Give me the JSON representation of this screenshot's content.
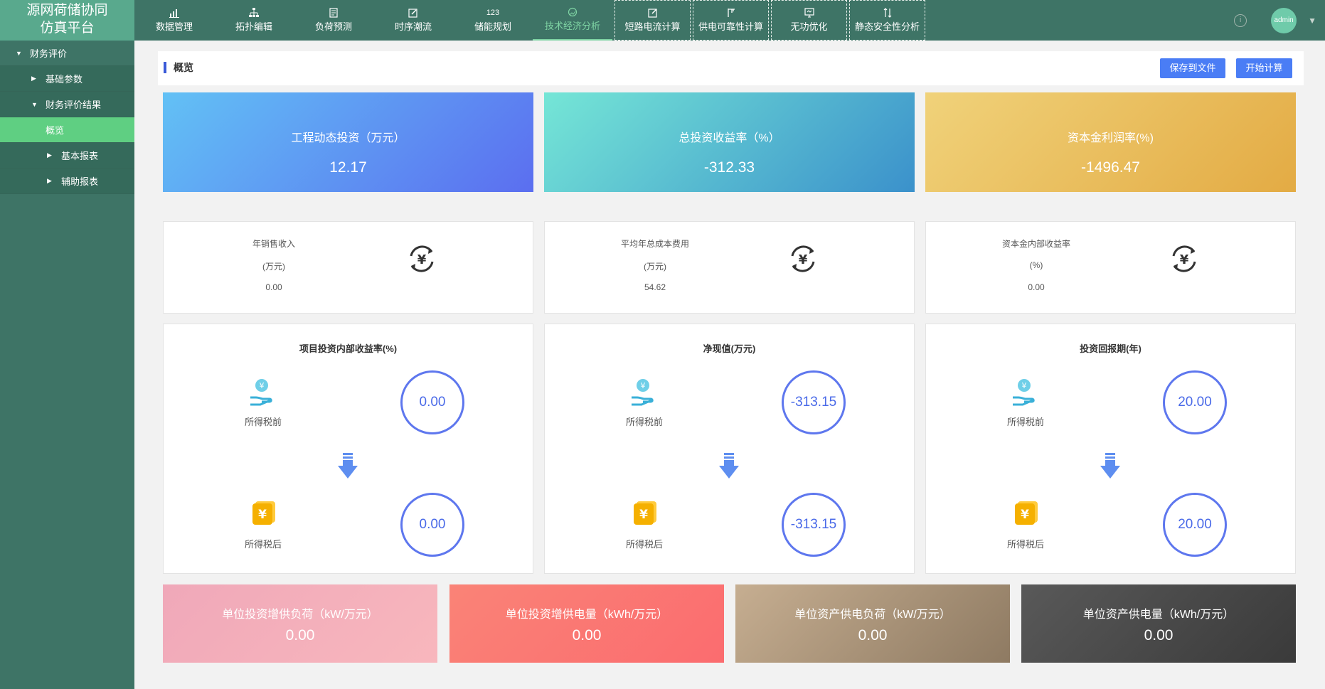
{
  "app": {
    "title_line1": "源网荷储协同",
    "title_line2": "仿真平台"
  },
  "nav": [
    {
      "label": "数据管理",
      "icon": "bar-chart-icon"
    },
    {
      "label": "拓扑编辑",
      "icon": "topology-icon"
    },
    {
      "label": "负荷预测",
      "icon": "document-icon"
    },
    {
      "label": "时序潮流",
      "icon": "edit-icon"
    },
    {
      "label": "储能规划",
      "icon": "numbers-icon",
      "icon_text": "123"
    },
    {
      "label": "技术经济分析",
      "icon": "chart-icon",
      "active": true
    },
    {
      "label": "短路电流计算",
      "icon": "edit-box-icon"
    },
    {
      "label": "供电可靠性计算",
      "icon": "tower-icon"
    },
    {
      "label": "无功优化",
      "icon": "monitor-icon"
    },
    {
      "label": "静态安全性分析",
      "icon": "transfer-icon"
    }
  ],
  "user": {
    "name": "admin"
  },
  "sidebar": {
    "items": [
      {
        "label": "财务评价",
        "level": 0,
        "arrow": "▼"
      },
      {
        "label": "基础参数",
        "level": 1,
        "arrow": "▶"
      },
      {
        "label": "财务评价结果",
        "level": 1,
        "arrow": "▼"
      },
      {
        "label": "概览",
        "level": 2,
        "arrow": "",
        "active": true
      },
      {
        "label": "基本报表",
        "level": 2,
        "arrow": "▶"
      },
      {
        "label": "辅助报表",
        "level": 2,
        "arrow": "▶"
      }
    ]
  },
  "header": {
    "title": "概览",
    "save_label": "保存到文件",
    "calc_label": "开始计算"
  },
  "top_cards": [
    {
      "title": "工程动态投资（万元）",
      "value": "12.17"
    },
    {
      "title": "总投资收益率（%）",
      "value": "-312.33"
    },
    {
      "title": "资本金利润率(%)",
      "value": "-1496.47"
    }
  ],
  "small_cards": [
    {
      "label": "年销售收入",
      "unit": "(万元)",
      "value": "0.00"
    },
    {
      "label": "平均年总成本费用",
      "unit": "(万元)",
      "value": "54.62"
    },
    {
      "label": "资本金内部收益率",
      "unit": "(%)",
      "value": "0.00"
    }
  ],
  "big_cards": [
    {
      "title": "项目投资内部收益率(%)",
      "before_label": "所得税前",
      "before_value": "0.00",
      "after_label": "所得税后",
      "after_value": "0.00"
    },
    {
      "title": "净现值(万元)",
      "before_label": "所得税前",
      "before_value": "-313.15",
      "after_label": "所得税后",
      "after_value": "-313.15"
    },
    {
      "title": "投资回报期(年)",
      "before_label": "所得税前",
      "before_value": "20.00",
      "after_label": "所得税后",
      "after_value": "20.00"
    }
  ],
  "bottom_cards": [
    {
      "title": "单位投资增供负荷（kW/万元）",
      "value": "0.00"
    },
    {
      "title": "单位投资增供电量（kWh/万元）",
      "value": "0.00"
    },
    {
      "title": "单位资产供电负荷（kW/万元）",
      "value": "0.00"
    },
    {
      "title": "单位资产供电量（kWh/万元）",
      "value": "0.00"
    }
  ],
  "colors": {
    "accent": "#4a7df5",
    "sidebar": "#3e7466",
    "active": "#5fcf82",
    "circle": "#5e77ee"
  }
}
